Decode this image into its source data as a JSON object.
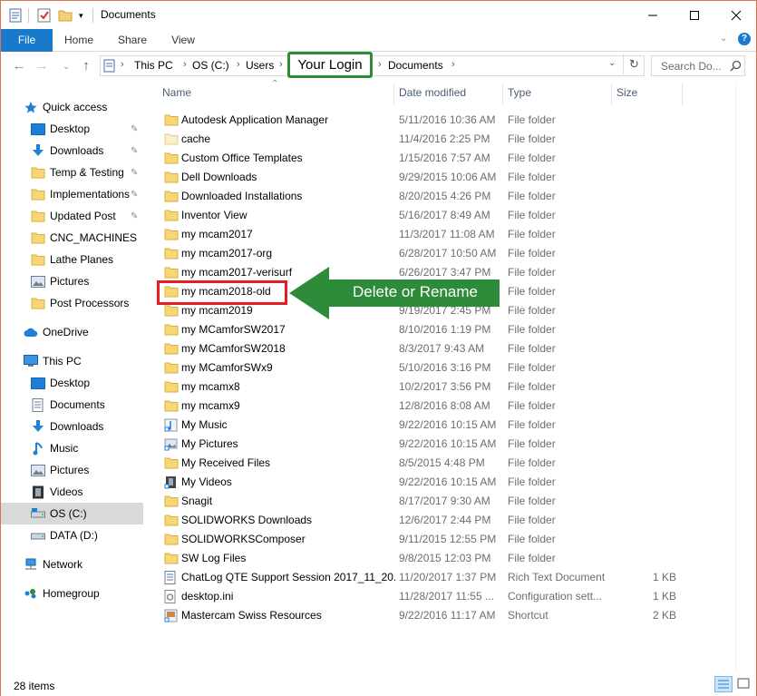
{
  "window": {
    "title": "Documents",
    "minimize_icon": "minimize-icon",
    "maximize_icon": "maximize-icon",
    "close_icon": "close-icon"
  },
  "ribbon": {
    "tabs": [
      "File",
      "Home",
      "Share",
      "View"
    ]
  },
  "address": {
    "crumbs": [
      "This PC",
      "OS (C:)",
      "Users",
      "Your Login",
      "Documents"
    ],
    "search_placeholder": "Search Do..."
  },
  "nav": {
    "items": [
      {
        "label": "Quick access",
        "icon": "star-icon",
        "color": "#1e7fd8"
      },
      {
        "label": "Desktop",
        "icon": "desktop-icon",
        "pinned": true
      },
      {
        "label": "Downloads",
        "icon": "download-arrow-icon",
        "pinned": true
      },
      {
        "label": "Temp & Testing",
        "icon": "folder-icon",
        "pinned": true
      },
      {
        "label": "Implementations",
        "icon": "folder-icon",
        "pinned": true
      },
      {
        "label": "Updated Post",
        "icon": "folder-icon",
        "pinned": true
      },
      {
        "label": "CNC_MACHINES",
        "icon": "folder-icon"
      },
      {
        "label": "Lathe Planes",
        "icon": "folder-icon"
      },
      {
        "label": "Pictures",
        "icon": "pictures-icon"
      },
      {
        "label": "Post Processors",
        "icon": "folder-icon"
      },
      {
        "label": "OneDrive",
        "icon": "cloud-icon"
      },
      {
        "label": "This PC",
        "icon": "computer-icon"
      },
      {
        "label": "Desktop",
        "icon": "desktop-icon"
      },
      {
        "label": "Documents",
        "icon": "document-icon"
      },
      {
        "label": "Downloads",
        "icon": "download-arrow-icon"
      },
      {
        "label": "Music",
        "icon": "music-note-icon"
      },
      {
        "label": "Pictures",
        "icon": "pictures-icon"
      },
      {
        "label": "Videos",
        "icon": "film-icon"
      },
      {
        "label": "OS (C:)",
        "icon": "drive-icon",
        "selected": true
      },
      {
        "label": "DATA (D:)",
        "icon": "drive-icon"
      },
      {
        "label": "Network",
        "icon": "network-icon"
      },
      {
        "label": "Homegroup",
        "icon": "homegroup-icon"
      }
    ]
  },
  "columns": {
    "name": "Name",
    "date": "Date modified",
    "type": "Type",
    "size": "Size"
  },
  "files": [
    {
      "name": "Autodesk Application Manager",
      "date": "5/11/2016 10:36 AM",
      "type": "File folder",
      "size": "",
      "icon": "folder-icon"
    },
    {
      "name": "cache",
      "date": "11/4/2016 2:25 PM",
      "type": "File folder",
      "size": "",
      "icon": "folder-empty-icon"
    },
    {
      "name": "Custom Office Templates",
      "date": "1/15/2016 7:57 AM",
      "type": "File folder",
      "size": "",
      "icon": "folder-icon"
    },
    {
      "name": "Dell Downloads",
      "date": "9/29/2015 10:06 AM",
      "type": "File folder",
      "size": "",
      "icon": "folder-icon"
    },
    {
      "name": "Downloaded Installations",
      "date": "8/20/2015 4:26 PM",
      "type": "File folder",
      "size": "",
      "icon": "folder-icon"
    },
    {
      "name": "Inventor View",
      "date": "5/16/2017 8:49 AM",
      "type": "File folder",
      "size": "",
      "icon": "folder-icon"
    },
    {
      "name": "my mcam2017",
      "date": "11/3/2017 11:08 AM",
      "type": "File folder",
      "size": "",
      "icon": "folder-icon"
    },
    {
      "name": "my mcam2017-org",
      "date": "6/28/2017 10:50 AM",
      "type": "File folder",
      "size": "",
      "icon": "folder-icon"
    },
    {
      "name": "my mcam2017-verisurf",
      "date": "6/26/2017 3:47 PM",
      "type": "File folder",
      "size": "",
      "icon": "folder-icon"
    },
    {
      "name": "my mcam2018-old",
      "date": "",
      "type": "File folder",
      "size": "",
      "icon": "folder-icon"
    },
    {
      "name": "my mcam2019",
      "date": "9/19/2017 2:45 PM",
      "type": "File folder",
      "size": "",
      "icon": "folder-icon"
    },
    {
      "name": "my MCamforSW2017",
      "date": "8/10/2016 1:19 PM",
      "type": "File folder",
      "size": "",
      "icon": "folder-icon"
    },
    {
      "name": "my MCamforSW2018",
      "date": "8/3/2017 9:43 AM",
      "type": "File folder",
      "size": "",
      "icon": "folder-icon"
    },
    {
      "name": "my MCamforSWx9",
      "date": "5/10/2016 3:16 PM",
      "type": "File folder",
      "size": "",
      "icon": "folder-icon"
    },
    {
      "name": "my mcamx8",
      "date": "10/2/2017 3:56 PM",
      "type": "File folder",
      "size": "",
      "icon": "folder-icon"
    },
    {
      "name": "my mcamx9",
      "date": "12/8/2016 8:08 AM",
      "type": "File folder",
      "size": "",
      "icon": "folder-icon"
    },
    {
      "name": "My Music",
      "date": "9/22/2016 10:15 AM",
      "type": "File folder",
      "size": "",
      "icon": "music-shortcut-icon"
    },
    {
      "name": "My Pictures",
      "date": "9/22/2016 10:15 AM",
      "type": "File folder",
      "size": "",
      "icon": "pictures-shortcut-icon"
    },
    {
      "name": "My Received Files",
      "date": "8/5/2015 4:48 PM",
      "type": "File folder",
      "size": "",
      "icon": "folder-icon"
    },
    {
      "name": "My Videos",
      "date": "9/22/2016 10:15 AM",
      "type": "File folder",
      "size": "",
      "icon": "video-shortcut-icon"
    },
    {
      "name": "Snagit",
      "date": "8/17/2017 9:30 AM",
      "type": "File folder",
      "size": "",
      "icon": "folder-icon"
    },
    {
      "name": "SOLIDWORKS Downloads",
      "date": "12/6/2017 2:44 PM",
      "type": "File folder",
      "size": "",
      "icon": "folder-icon"
    },
    {
      "name": "SOLIDWORKSComposer",
      "date": "9/11/2015 12:55 PM",
      "type": "File folder",
      "size": "",
      "icon": "folder-icon"
    },
    {
      "name": "SW Log Files",
      "date": "9/8/2015 12:03 PM",
      "type": "File folder",
      "size": "",
      "icon": "folder-icon"
    },
    {
      "name": "ChatLog QTE Support Session 2017_11_20...",
      "date": "11/20/2017 1:37 PM",
      "type": "Rich Text Document",
      "size": "1 KB",
      "icon": "rtf-document-icon"
    },
    {
      "name": "desktop.ini",
      "date": "11/28/2017 11:55 ...",
      "type": "Configuration sett...",
      "size": "1 KB",
      "icon": "config-file-icon"
    },
    {
      "name": "Mastercam Swiss Resources",
      "date": "9/22/2016 11:17 AM",
      "type": "Shortcut",
      "size": "2 KB",
      "icon": "shortcut-icon"
    }
  ],
  "status": {
    "item_count": "28 items"
  },
  "callouts": {
    "arrow_label": "Delete or Rename",
    "login_label": "Your Login",
    "arrow_color": "#2e8b3a",
    "highlight_color": "#e31e24"
  }
}
